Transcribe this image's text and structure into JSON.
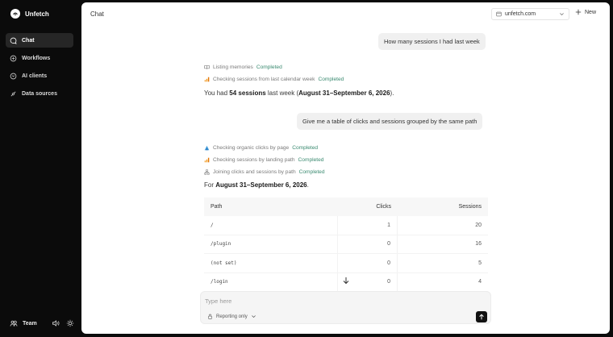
{
  "app": {
    "name": "Unfetch"
  },
  "sidebar": {
    "items": [
      {
        "label": "Chat",
        "icon": "chat-icon",
        "active": true
      },
      {
        "label": "Workflows",
        "icon": "workflows-icon"
      },
      {
        "label": "AI clients",
        "icon": "ai-clients-icon"
      },
      {
        "label": "Data sources",
        "icon": "data-sources-icon"
      }
    ],
    "footer": {
      "team_label": "Team",
      "icons": [
        "speaker-icon",
        "sun-icon"
      ]
    }
  },
  "header": {
    "title": "Chat",
    "site_select": "unfetch.com",
    "new_label": "New"
  },
  "conversation": {
    "msg1": "How many sessions I had last week",
    "steps1": [
      {
        "icon": "book-icon",
        "text": "Listing memories",
        "status": "Completed"
      },
      {
        "icon": "bar-chart-icon",
        "text": "Checking sessions from last calendar week",
        "status": "Completed"
      }
    ],
    "answer1": {
      "pre": "You had ",
      "count": "54 sessions",
      "mid": " last week (",
      "range": "August 31–September 6, 2026",
      "post": ")."
    },
    "msg2": "Give me a table of clicks and sessions grouped by the same path",
    "steps2": [
      {
        "icon": "search-console-icon",
        "text": "Checking organic clicks by page",
        "status": "Completed"
      },
      {
        "icon": "bar-chart-icon",
        "text": "Checking sessions by landing path",
        "status": "Completed"
      },
      {
        "icon": "join-icon",
        "text": "Joining clicks and sessions by path",
        "status": "Completed"
      }
    ],
    "answer2": {
      "pre": "For ",
      "range": "August 31–September 6, 2026",
      "post": "."
    },
    "table": {
      "headers": [
        "Path",
        "Clicks",
        "Sessions"
      ],
      "rows": [
        [
          "/",
          "1",
          "20"
        ],
        [
          "/plugin",
          "0",
          "16"
        ],
        [
          "(not set)",
          "0",
          "5"
        ],
        [
          "/login",
          "0",
          "4"
        ]
      ]
    }
  },
  "composer": {
    "placeholder": "Type here",
    "mode_label": "Reporting only"
  },
  "colors": {
    "completed": "#3a8a70",
    "sidebar_bg": "#0b0b0b",
    "active_nav": "#262626"
  }
}
